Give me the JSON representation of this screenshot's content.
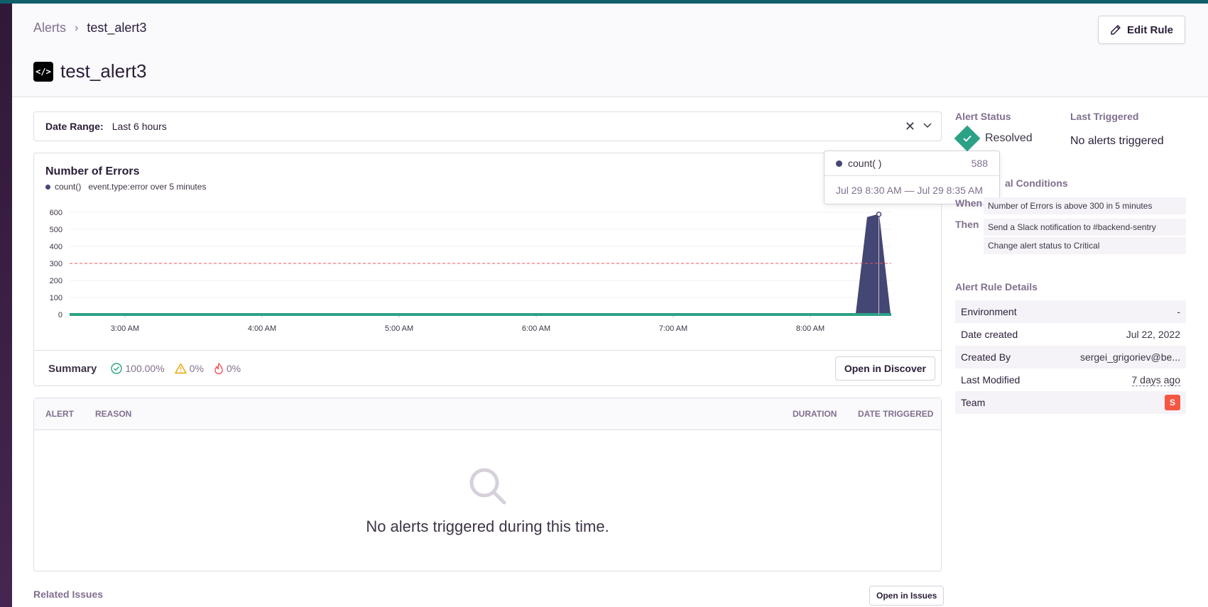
{
  "breadcrumb": {
    "parent": "Alerts",
    "current": "test_alert3"
  },
  "page": {
    "title": "test_alert3",
    "edit_label": "Edit Rule",
    "project_icon": "code-icon"
  },
  "date_range": {
    "label": "Date Range:",
    "value": "Last 6 hours"
  },
  "chart": {
    "title": "Number of Errors",
    "series_label": "count()",
    "query": "event.type:error over 5 minutes"
  },
  "chart_data": {
    "type": "area",
    "title": "Number of Errors",
    "x_ticks": [
      "3:00 AM",
      "4:00 AM",
      "5:00 AM",
      "6:00 AM",
      "7:00 AM",
      "8:00 AM"
    ],
    "y_ticks": [
      0,
      100,
      200,
      300,
      400,
      500,
      600
    ],
    "ylim": [
      0,
      600
    ],
    "threshold": 300,
    "series": [
      {
        "name": "count()",
        "x": [
          "8:20 AM",
          "8:25 AM",
          "8:30 AM",
          "8:35 AM"
        ],
        "values": [
          0,
          570,
          588,
          0
        ]
      }
    ],
    "grid": true,
    "colors": {
      "series": "#444674",
      "threshold": "#f55459",
      "baseline": "#2ba185"
    }
  },
  "tooltip": {
    "series": "count( )",
    "value": "588",
    "range": "Jul 29 8:30 AM — Jul 29 8:35 AM"
  },
  "summary": {
    "label": "Summary",
    "resolved_pct": "100.00%",
    "warning_pct": "0%",
    "critical_pct": "0%",
    "discover_label": "Open in Discover"
  },
  "table": {
    "headers": {
      "alert": "Alert",
      "reason": "Reason",
      "duration": "Duration",
      "date_triggered": "Date Triggered"
    },
    "empty_text": "No alerts triggered during this time."
  },
  "related": {
    "label": "Related Issues",
    "button": "Open in Issues"
  },
  "side": {
    "alert_status_label": "Alert Status",
    "alert_status_value": "Resolved",
    "last_triggered_label": "Last Triggered",
    "last_triggered_value": "No alerts triggered",
    "conditions_label": "Critical Conditions",
    "conditions_visible_label": "al Conditions",
    "when_key": "When",
    "when_value": "Number of Errors is above 300 in 5 minutes",
    "then_key": "Then",
    "then_values": [
      "Send a Slack notification to #backend-sentry",
      "Change alert status to Critical"
    ],
    "details_label": "Alert Rule Details",
    "details": {
      "environment_key": "Environment",
      "environment_val": "-",
      "created_key": "Date created",
      "created_val": "Jul 22, 2022",
      "by_key": "Created By",
      "by_val": "sergei_grigoriev@be...",
      "modified_key": "Last Modified",
      "modified_val": "7 days ago",
      "team_key": "Team",
      "team_val": "S"
    }
  }
}
